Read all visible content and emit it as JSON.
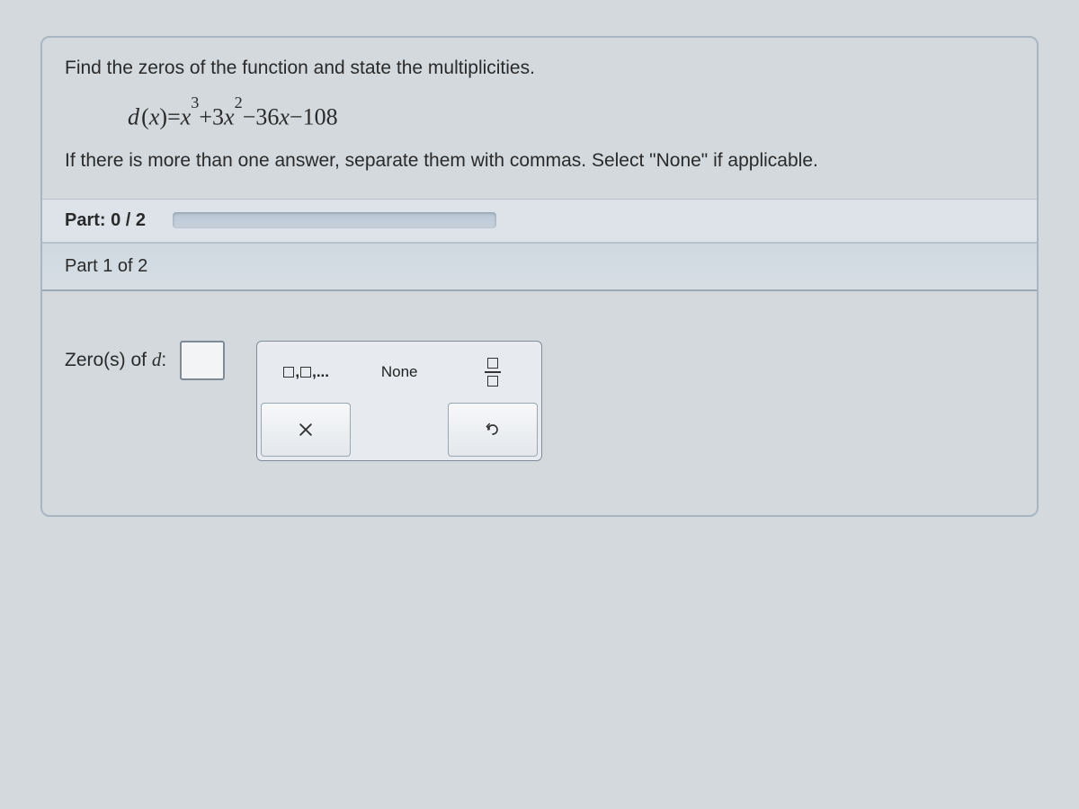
{
  "question": {
    "line1": "Find the zeros of the function and state the multiplicities.",
    "function_lhs_name": "d",
    "function_lhs_var": "x",
    "term1_var": "x",
    "term1_exp": "3",
    "term2_coef": "+3",
    "term2_var": "x",
    "term2_exp": "2",
    "term3": "−36",
    "term3_var": "x",
    "term4": "−108",
    "line2": "If there is more than one answer, separate them with commas. Select \"None\" if applicable."
  },
  "progress": {
    "label": "Part: 0 / 2"
  },
  "part": {
    "header": "Part 1 of 2",
    "prompt_prefix": "Zero(s) of ",
    "prompt_var": "d",
    "prompt_suffix": ":",
    "tools": {
      "list_sep": ",...",
      "none_label": "None"
    }
  }
}
